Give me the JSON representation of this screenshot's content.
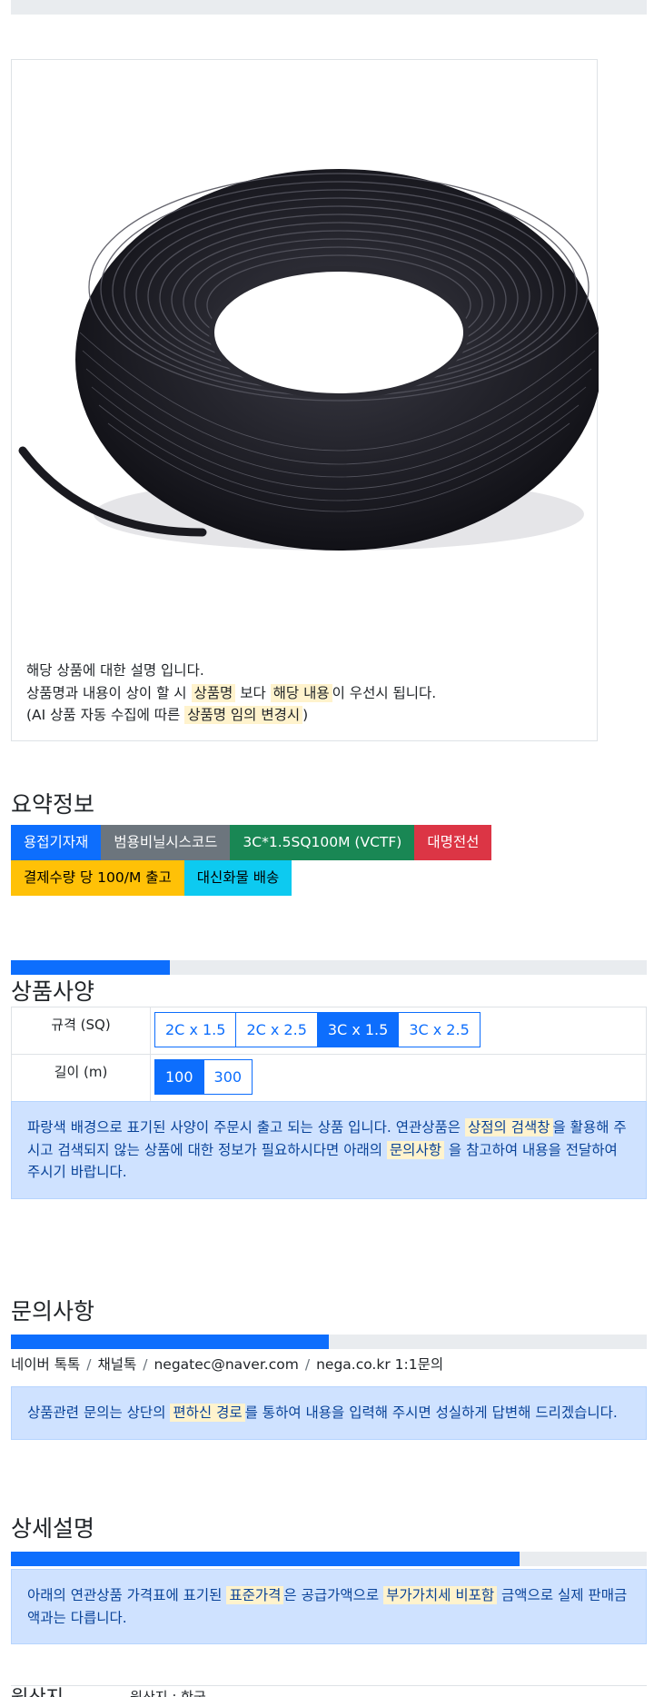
{
  "product": {
    "image_icon": "cable-coil-photo",
    "desc_line1": "해당 상품에 대한 설명 입니다.",
    "desc_line2_pre": "상품명과 내용이 상이 할 시 ",
    "desc_line2_hl1": "상품명",
    "desc_line2_mid": " 보다 ",
    "desc_line2_hl2": "해당 내용",
    "desc_line2_post": "이 우선시 됩니다.",
    "desc_line3_pre": "(AI 상품 자동 수집에 따른 ",
    "desc_line3_hl": "상품명 임의 변경시",
    "desc_line3_post": ")"
  },
  "summary": {
    "title": "요약정보",
    "badges_row1": [
      "용접기자재",
      "범용비닐시스코드",
      "3C*1.5SQ100M (VCTF)",
      "대명전선"
    ],
    "badges_row2": [
      "결제수량 당 100/M 출고",
      "대신화물 배송"
    ]
  },
  "spec": {
    "title": "상품사양",
    "progress_percent": 25,
    "size_label": "규격 (SQ)",
    "size_options": [
      "2C x 1.5",
      "2C x 2.5",
      "3C x 1.5",
      "3C x 2.5"
    ],
    "size_selected": "3C x 1.5",
    "length_label": "길이 (m)",
    "length_options": [
      "100",
      "300"
    ],
    "length_selected": "100",
    "notice_pre": "파랑색 배경으로 표기된 사양이 주문시 출고 되는 상품 입니다. 연관상품은 ",
    "notice_hl1": "상점의 검색창",
    "notice_mid": "을 활용해 주시고 검색되지 않는 상품에 대한 정보가 필요하시다면 아래의 ",
    "notice_hl2": "문의사항",
    "notice_post": " 을 참고하여 내용을 전달하여 주시기 바랍니다."
  },
  "inquiry": {
    "title": "문의사항",
    "progress_percent": 50,
    "contacts": [
      "네이버 톡톡",
      "채널톡",
      "negatec@naver.com",
      "nega.co.kr 1:1문의"
    ],
    "notice_pre": "상품관련 문의는 상단의 ",
    "notice_hl": "편하신 경로",
    "notice_post": "를 통하여 내용을 입력해 주시면 성실하게 답변해 드리겠습니다."
  },
  "detail": {
    "title": "상세설명",
    "progress_percent": 80,
    "notice_pre": "아래의 연관상품 가격표에 표기된 ",
    "notice_hl1": "표준가격",
    "notice_mid": "은 공급가액으로 ",
    "notice_hl2": "부가가치세 비포함",
    "notice_post": " 금액으로 실제 판매금액과는 다릅니다."
  },
  "origin": {
    "label": "원산지",
    "value": "- 원산지 : 한국"
  }
}
